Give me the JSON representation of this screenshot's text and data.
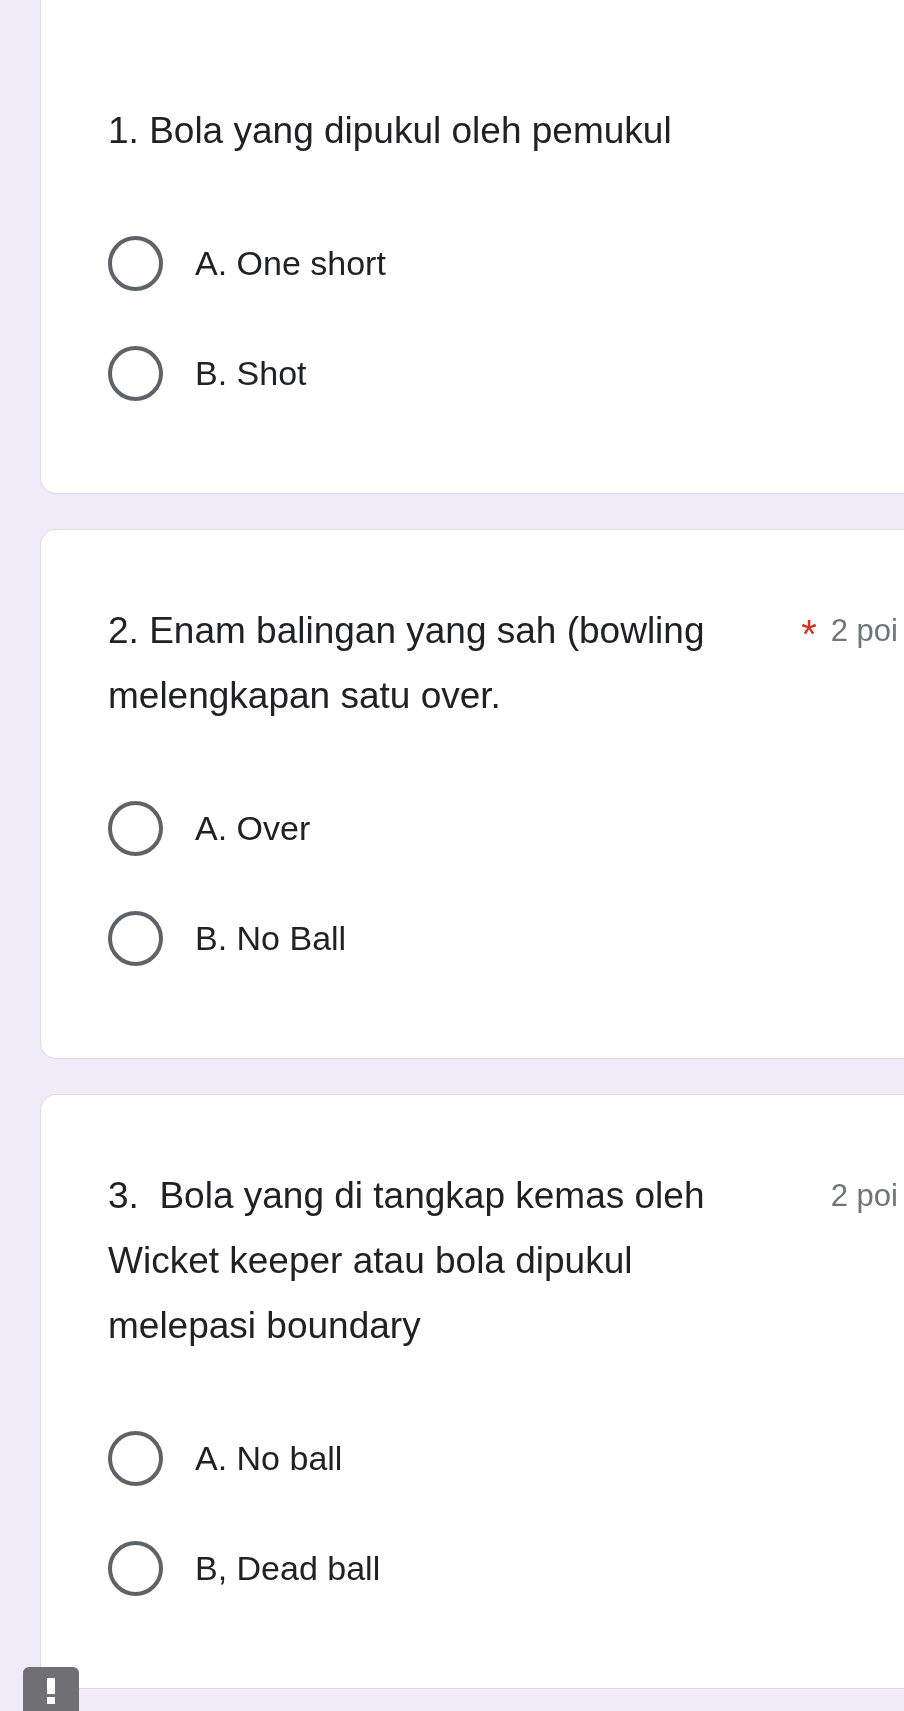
{
  "questions": [
    {
      "title": "1. Bola yang dipukul oleh pemukul",
      "options": [
        {
          "label": "A. One short",
          "selected": false
        },
        {
          "label": "B. Shot",
          "selected": false
        }
      ]
    },
    {
      "title": "2. Enam balingan yang sah (bowling melengkapan satu over.",
      "asterisk": "*",
      "points": "2 poi",
      "options": [
        {
          "label": "A. Over",
          "selected": false
        },
        {
          "label": "B. No Ball",
          "selected": false
        }
      ]
    },
    {
      "title": "3.  Bola yang di tangkap kemas oleh Wicket keeper atau bola dipukul melepasi boundary",
      "points": "2 poi",
      "options": [
        {
          "label": "A. No ball",
          "selected": false
        },
        {
          "label": "B, Dead ball",
          "selected": false
        }
      ]
    }
  ]
}
